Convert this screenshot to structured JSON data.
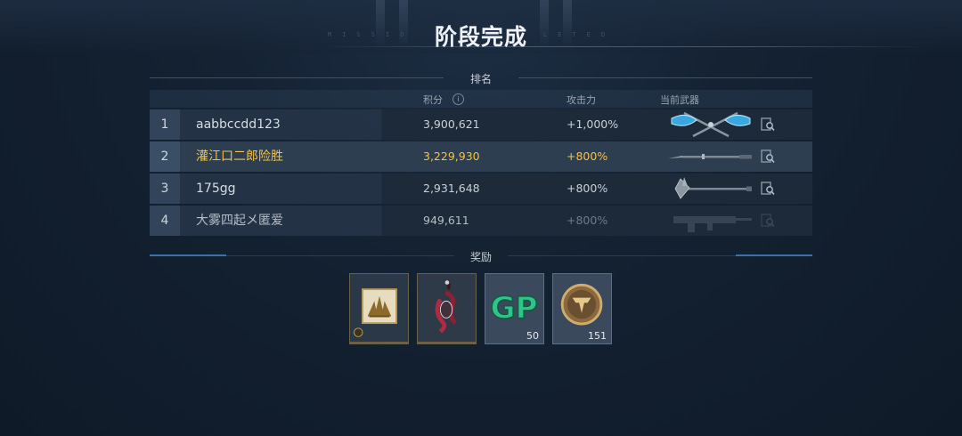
{
  "header": {
    "title": "阶段完成",
    "subtitle_left": "MISSIO",
    "subtitle_right": "LETED"
  },
  "ranking": {
    "section_label": "排名",
    "columns": {
      "score": "积分",
      "info_icon": "i",
      "attack": "攻击力",
      "weapon": "当前武器"
    },
    "rows": [
      {
        "rank": "1",
        "name": "aabbccdd123",
        "score": "3,900,621",
        "attack": "+1,000%",
        "weapon": "twin-axes-icon",
        "highlight": false
      },
      {
        "rank": "2",
        "name": "灌江口二郎险胜",
        "score": "3,229,930",
        "attack": "+800%",
        "weapon": "spear-icon",
        "highlight": true
      },
      {
        "rank": "3",
        "name": "175gg",
        "score": "2,931,648",
        "attack": "+800%",
        "weapon": "halberd-icon",
        "highlight": false
      },
      {
        "rank": "4",
        "name": "大雾四起メ匿爱",
        "score": "949,611",
        "attack": "+800%",
        "weapon": "rifle-icon",
        "highlight": false
      }
    ],
    "highlight_color": "#f2c14e"
  },
  "rewards": {
    "section_label": "奖励",
    "items": [
      {
        "icon": "burst-emblem-icon",
        "count": ""
      },
      {
        "icon": "scorpion-figure-icon",
        "count": ""
      },
      {
        "icon": "gp-currency-icon",
        "count": "50"
      },
      {
        "icon": "medal-coin-icon",
        "count": "151"
      }
    ],
    "accent_color": "#c8a24a"
  }
}
